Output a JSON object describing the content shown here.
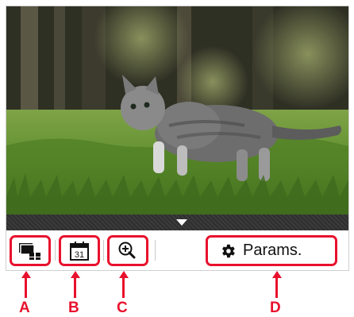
{
  "photo": {
    "subject": "kitten-photo"
  },
  "toolbar": {
    "params_label": "Params."
  },
  "callouts": {
    "a": "A",
    "b": "B",
    "c": "C",
    "d": "D"
  },
  "icons": {
    "layout": "multi-image-layout-icon",
    "calendar": "calendar-icon",
    "calendar_day": "31",
    "zoom": "zoom-in-icon",
    "settings": "gear-icon"
  },
  "colors": {
    "callout_red": "#e8112d"
  }
}
